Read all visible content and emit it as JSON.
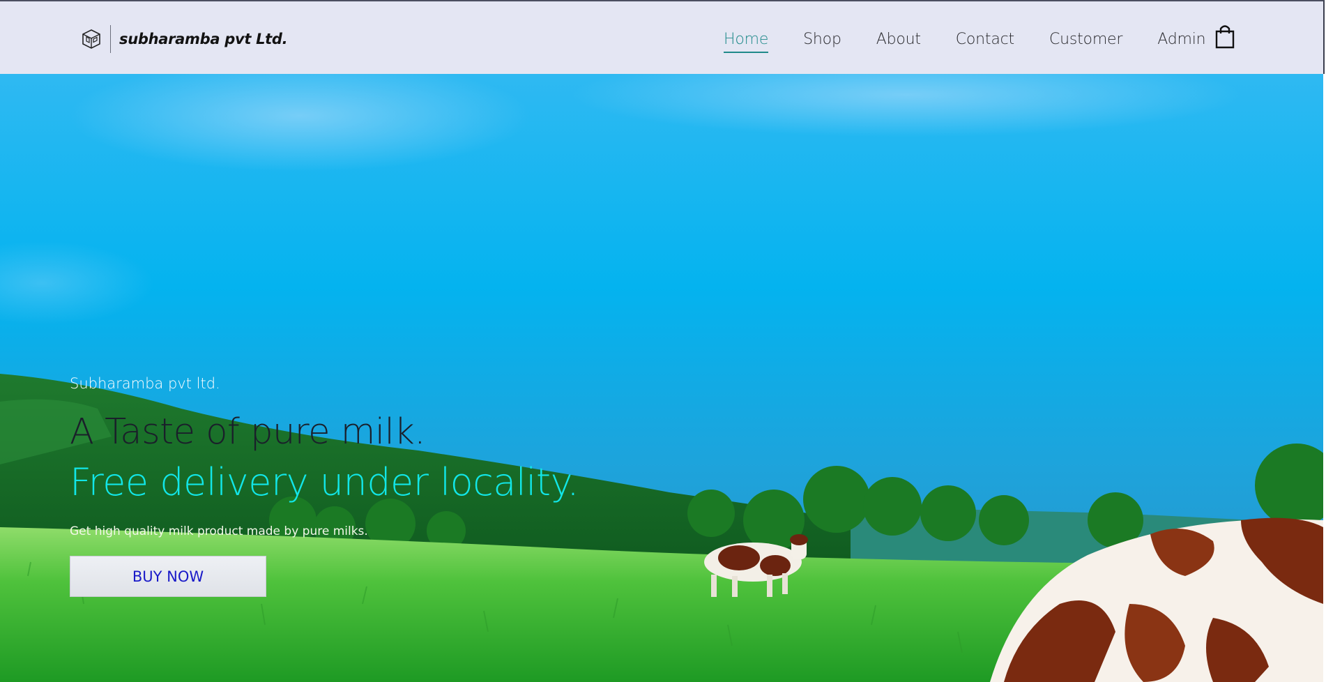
{
  "brand": {
    "name": "subharamba pvt Ltd.",
    "logo_icon": "cube-box-icon"
  },
  "nav": {
    "items": [
      {
        "label": "Home",
        "active": true
      },
      {
        "label": "Shop",
        "active": false
      },
      {
        "label": "About",
        "active": false
      },
      {
        "label": "Contact",
        "active": false
      },
      {
        "label": "Customer",
        "active": false
      },
      {
        "label": "Admin",
        "active": false
      }
    ],
    "cart_icon": "shopping-bag-icon"
  },
  "hero": {
    "eyebrow": "Subharamba pvt ltd.",
    "headline": "A Taste of pure milk.",
    "subhead": "Free delivery under locality.",
    "description": "Get high quality milk product made by pure milks.",
    "cta_label": "BUY NOW"
  },
  "colors": {
    "header_bg": "#e4e6f3",
    "nav_active": "#1f8a8a",
    "subhead": "#12e6e8",
    "cta_text": "#1919c8",
    "sky": "#05b2ee"
  }
}
